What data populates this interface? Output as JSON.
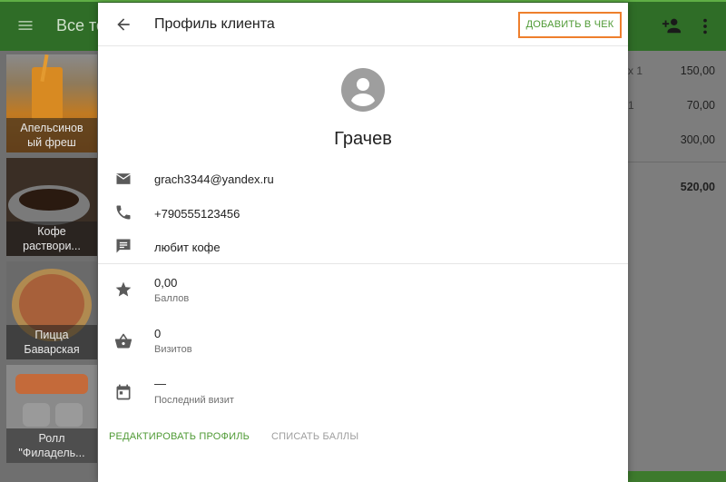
{
  "app": {
    "title": "Все то",
    "colors": {
      "appbar": "#2f6d27",
      "accent_green": "#4f9a35",
      "highlight_orange": "#ee7f2d"
    }
  },
  "products": [
    {
      "name_line1": "Апельсинов",
      "name_line2": "ый фреш",
      "image": "orange-juice"
    },
    {
      "name_line1": "Кофе",
      "name_line2": "раствори...",
      "image": "coffee-cup"
    },
    {
      "name_line1": "Пицца",
      "name_line2": "Баварская",
      "image": "pizza"
    },
    {
      "name_line1": "Ролл",
      "name_line2": "\"Филадель...",
      "image": "sushi-roll"
    }
  ],
  "receipt": {
    "lines": [
      {
        "qty": "x 1",
        "amount": "150,00"
      },
      {
        "qty": "1",
        "amount": "70,00"
      },
      {
        "qty": "",
        "amount": "300,00"
      }
    ],
    "total": "520,00"
  },
  "dialog": {
    "back_icon": "arrow-back-icon",
    "title": "Профиль клиента",
    "add_to_receipt": "ДОБАВИТЬ В ЧЕК",
    "client_name": "Грачев",
    "contacts": {
      "email": "grach3344@yandex.ru",
      "phone": "+790555123456",
      "comment": "любит кофе"
    },
    "stats": {
      "points_value": "0,00",
      "points_label": "Баллов",
      "visits_value": "0",
      "visits_label": "Визитов",
      "last_visit_value": "—",
      "last_visit_label": "Последний визит"
    },
    "actions": {
      "edit_profile": "РЕДАКТИРОВАТЬ ПРОФИЛЬ",
      "spend_points": "СПИСАТЬ БАЛЛЫ"
    }
  }
}
